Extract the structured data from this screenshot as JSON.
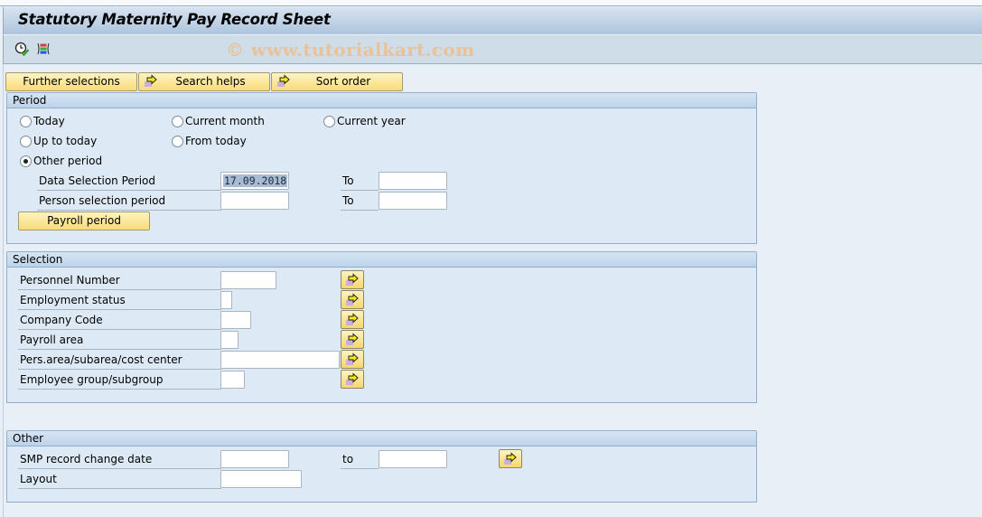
{
  "window": {
    "title": "Statutory Maternity Pay Record Sheet",
    "watermark": "© www.tutorialkart.com"
  },
  "toolbar": {
    "icons": [
      "execute-icon",
      "select-options-icon"
    ]
  },
  "buttons": {
    "further_selections": "Further selections",
    "search_helps": "Search helps",
    "sort_order": "Sort order"
  },
  "period": {
    "title": "Period",
    "radios": [
      {
        "label": "Today",
        "selected": false
      },
      {
        "label": "Current month",
        "selected": false
      },
      {
        "label": "Current year",
        "selected": false
      },
      {
        "label": "Up to today",
        "selected": false
      },
      {
        "label": "From today",
        "selected": false
      },
      {
        "label": "Other period",
        "selected": true
      }
    ],
    "data_selection_label": "Data Selection Period",
    "data_selection_from": "17.09.2018",
    "data_selection_to": "",
    "person_selection_label": "Person selection period",
    "person_selection_from": "",
    "person_selection_to": "",
    "to_label": "To",
    "payroll_period_button": "Payroll period"
  },
  "selection": {
    "title": "Selection",
    "fields": [
      {
        "label": "Personnel Number",
        "value": ""
      },
      {
        "label": "Employment status",
        "value": ""
      },
      {
        "label": "Company Code",
        "value": ""
      },
      {
        "label": "Payroll area",
        "value": ""
      },
      {
        "label": "Pers.area/subarea/cost center",
        "value": ""
      },
      {
        "label": "Employee group/subgroup",
        "value": ""
      }
    ]
  },
  "other": {
    "title": "Other",
    "smp_label": "SMP record change date",
    "smp_from": "",
    "to_label": "to",
    "smp_to": "",
    "layout_label": "Layout",
    "layout_value": ""
  }
}
